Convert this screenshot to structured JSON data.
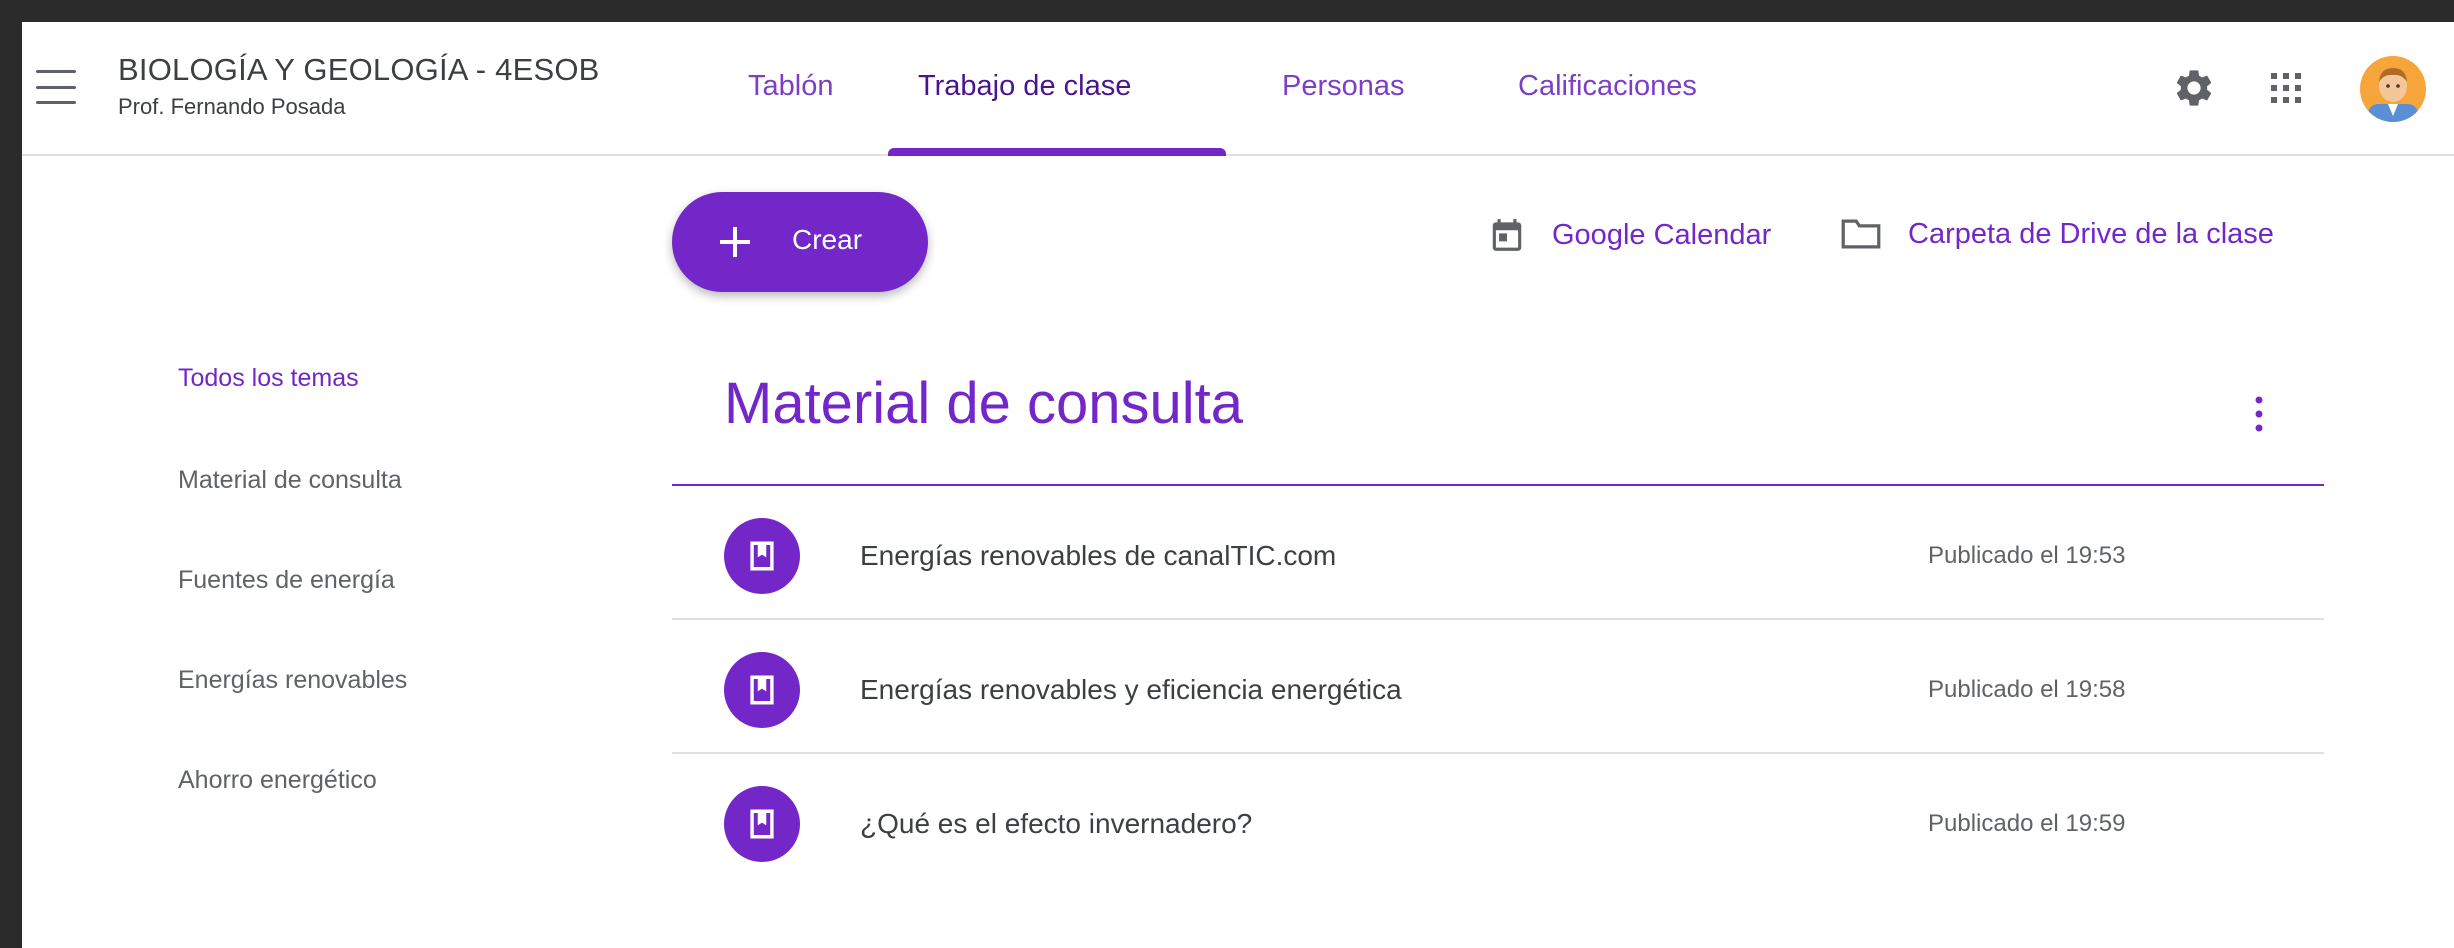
{
  "header": {
    "class_title": "BIOLOGÍA Y GEOLOGÍA - 4ESOB",
    "teacher": "Prof. Fernando Posada",
    "tabs": [
      {
        "label": "Tablón"
      },
      {
        "label": "Trabajo de clase",
        "active": true
      },
      {
        "label": "Personas"
      },
      {
        "label": "Calificaciones"
      }
    ],
    "icons": [
      "menu-icon",
      "settings-icon",
      "apps-icon",
      "avatar"
    ]
  },
  "actions": {
    "create_label": "Crear",
    "calendar_label": "Google Calendar",
    "drive_label": "Carpeta de Drive de la clase"
  },
  "sidebar": {
    "items": [
      {
        "label": "Todos los temas",
        "active": true
      },
      {
        "label": "Material de consulta"
      },
      {
        "label": "Fuentes de energía"
      },
      {
        "label": "Energías renovables"
      },
      {
        "label": "Ahorro energético"
      }
    ]
  },
  "topic": {
    "title": "Material de consulta",
    "items": [
      {
        "title": "Energías renovables de canalTIC.com",
        "date": "Publicado el 19:53"
      },
      {
        "title": "Energías renovables y eficiencia energética",
        "date": "Publicado el 19:58"
      },
      {
        "title": "¿Qué es el efecto invernadero?",
        "date": "Publicado el 19:59"
      }
    ]
  },
  "colors": {
    "accent": "#7327c8",
    "tab_active": "#4a148c",
    "text": "#3c4043",
    "muted": "#5f6368",
    "frame_bg": "#2b2b2b"
  }
}
